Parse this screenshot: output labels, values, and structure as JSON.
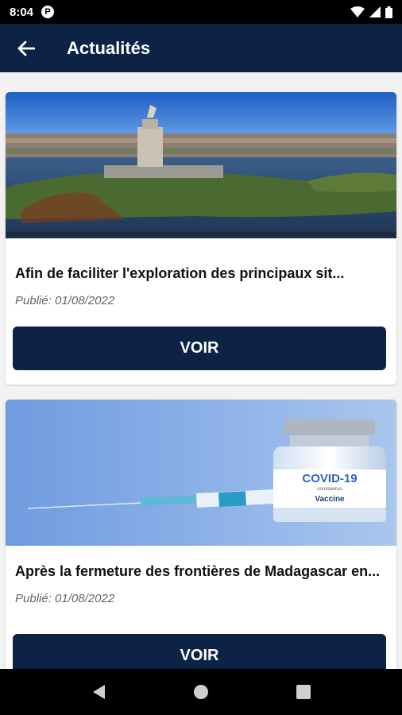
{
  "status_bar": {
    "time": "8:04",
    "badge": "P"
  },
  "app_bar": {
    "title": "Actualités"
  },
  "articles": [
    {
      "title": "Afin de faciliter l'exploration des principaux sit...",
      "date": "Publié: 01/08/2022",
      "button": "VOIR"
    },
    {
      "title": "Après la fermeture des frontières de Madagascar en...",
      "date": "Publié: 01/08/2022",
      "button": "VOIR"
    }
  ],
  "vaccine_label": {
    "line1": "COVID-19",
    "line2": "coronavirus",
    "line3": "Vaccine"
  },
  "colors": {
    "primary": "#0c2345",
    "background": "#f2f2f2"
  }
}
